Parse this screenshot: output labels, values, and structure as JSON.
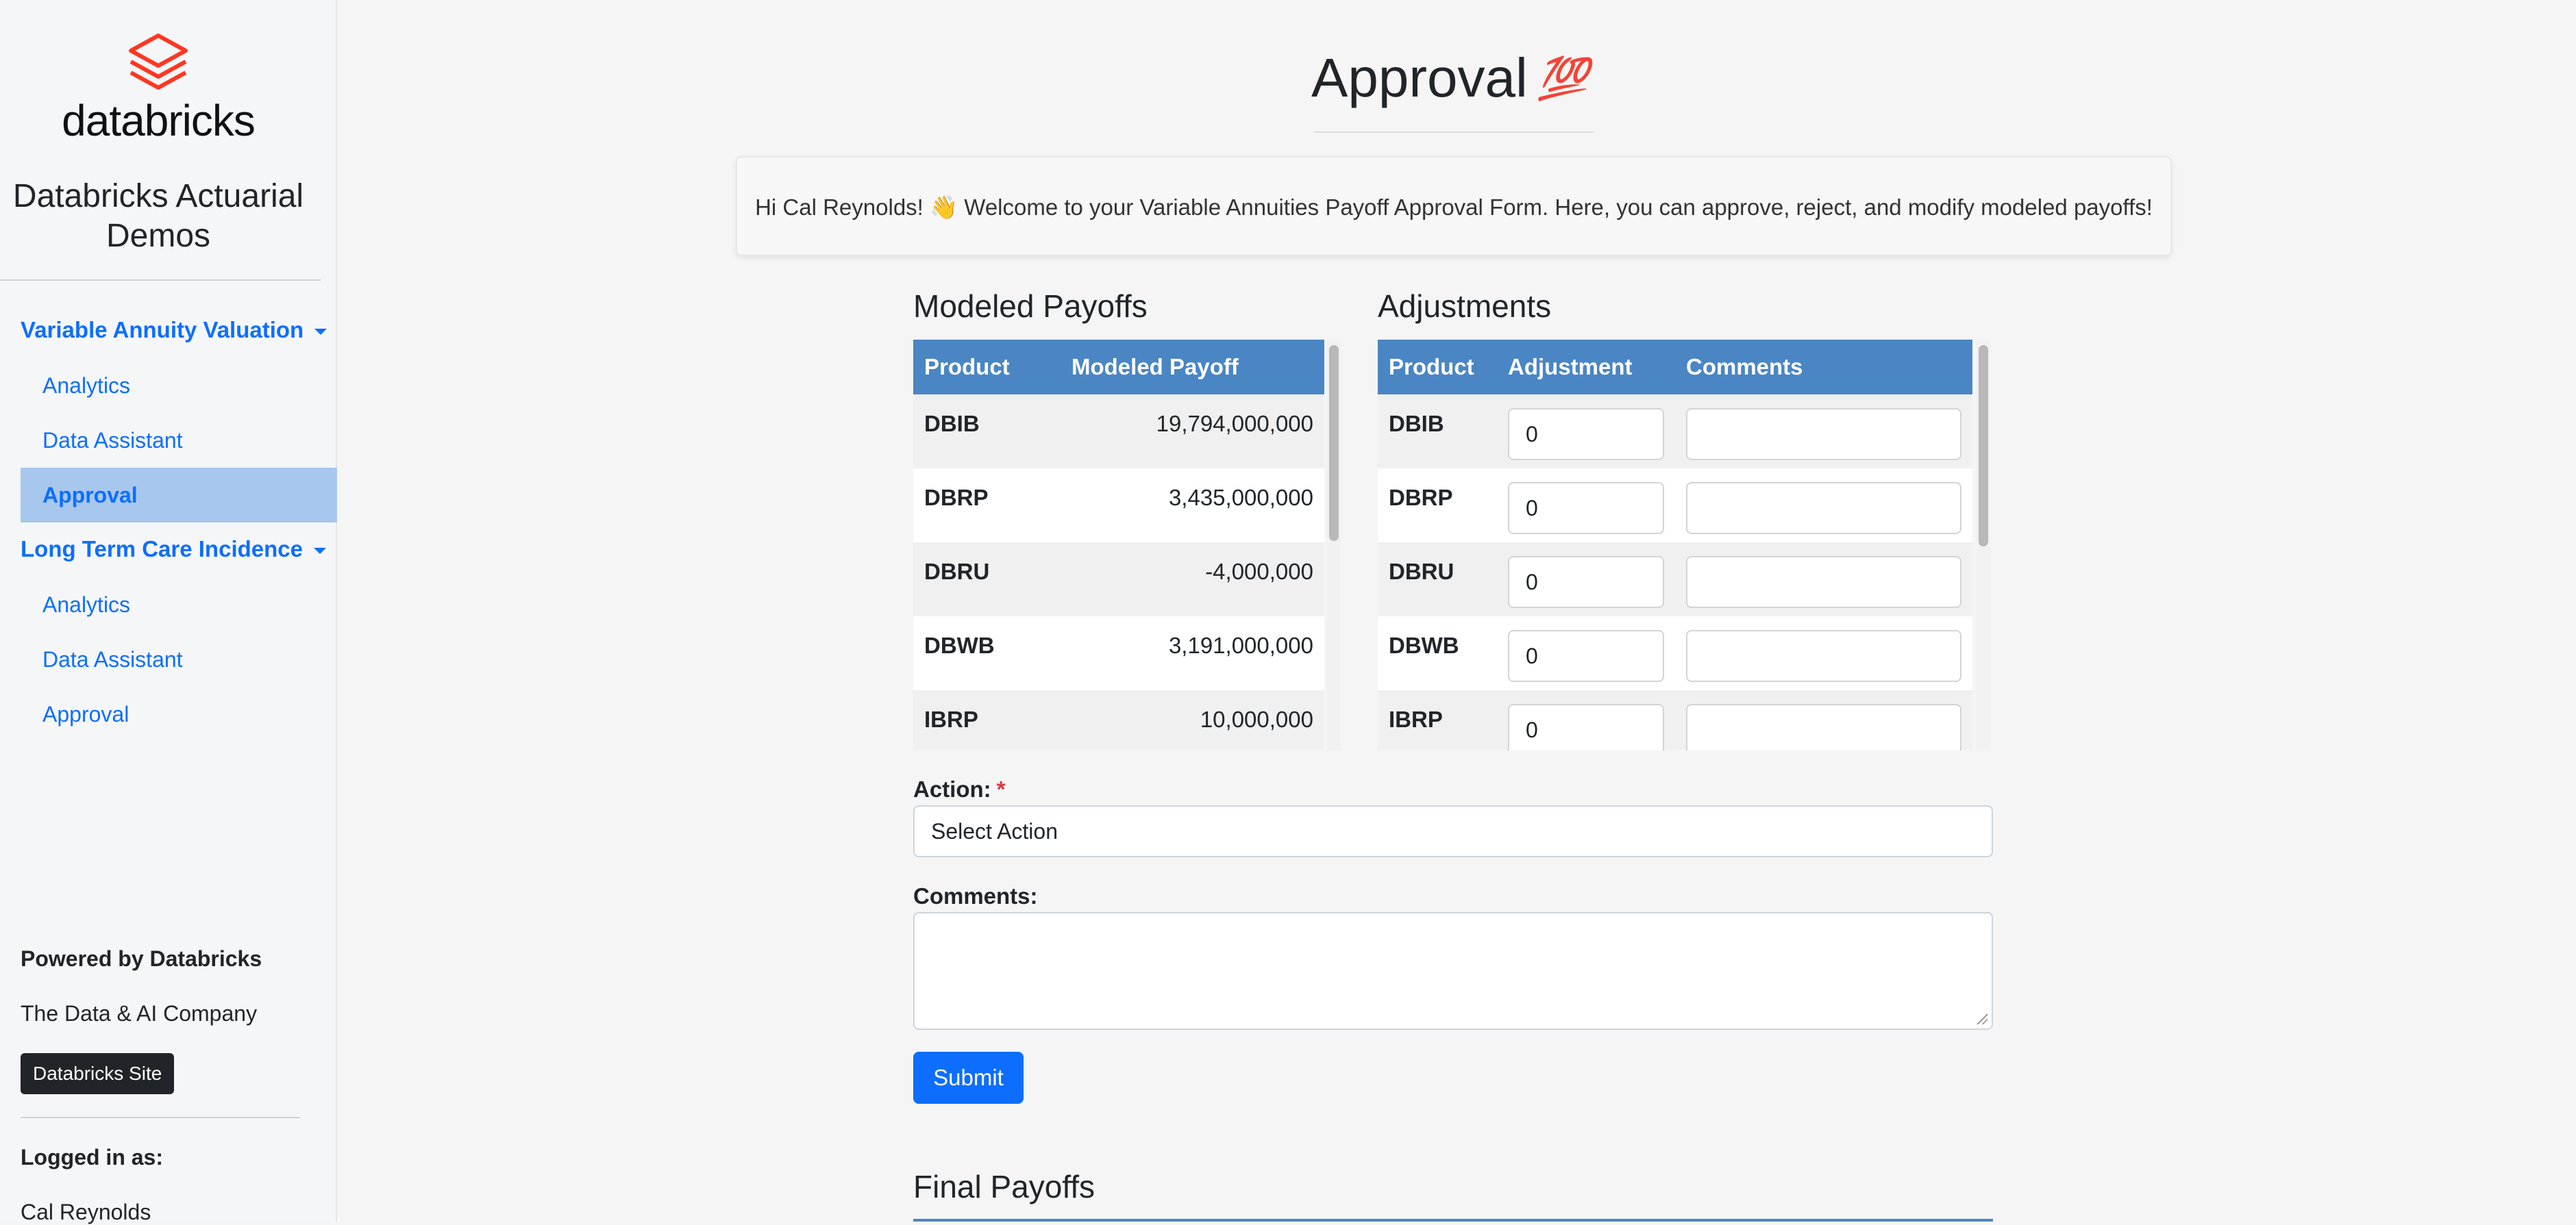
{
  "sidebar": {
    "brand": "databricks",
    "app_title": "Databricks Actuarial Demos",
    "sections": [
      {
        "label": "Variable Annuity Valuation",
        "items": [
          {
            "label": "Analytics",
            "active": false
          },
          {
            "label": "Data Assistant",
            "active": false
          },
          {
            "label": "Approval",
            "active": true
          }
        ]
      },
      {
        "label": "Long Term Care Incidence",
        "items": [
          {
            "label": "Analytics",
            "active": false
          },
          {
            "label": "Data Assistant",
            "active": false
          },
          {
            "label": "Approval",
            "active": false
          }
        ]
      }
    ],
    "powered_title": "Powered by Databricks",
    "powered_sub": "The Data & AI Company",
    "site_button": "Databricks Site",
    "logged_in_label": "Logged in as:",
    "logged_in_user": "Cal Reynolds"
  },
  "main": {
    "title": "Approval",
    "title_emoji": "💯",
    "welcome": "Hi Cal Reynolds! 👋 Welcome to your Variable Annuities Payoff Approval Form. Here, you can approve, reject, and modify modeled payoffs!",
    "modeled": {
      "heading": "Modeled Payoffs",
      "columns": [
        "Product",
        "Modeled Payoff"
      ],
      "rows": [
        {
          "product": "DBIB",
          "payoff": "19,794,000,000"
        },
        {
          "product": "DBRP",
          "payoff": "3,435,000,000"
        },
        {
          "product": "DBRU",
          "payoff": "-4,000,000"
        },
        {
          "product": "DBWB",
          "payoff": "3,191,000,000"
        },
        {
          "product": "IBRP",
          "payoff": "10,000,000"
        }
      ]
    },
    "adjustments": {
      "heading": "Adjustments",
      "columns": [
        "Product",
        "Adjustment",
        "Comments"
      ],
      "rows": [
        {
          "product": "DBIB",
          "adjustment": "0",
          "comment": ""
        },
        {
          "product": "DBRP",
          "adjustment": "0",
          "comment": ""
        },
        {
          "product": "DBRU",
          "adjustment": "0",
          "comment": ""
        },
        {
          "product": "DBWB",
          "adjustment": "0",
          "comment": ""
        },
        {
          "product": "IBRP",
          "adjustment": "0",
          "comment": ""
        }
      ]
    },
    "form": {
      "action_label": "Action:",
      "action_required_mark": "*",
      "action_value": "Select Action",
      "comments_label": "Comments:",
      "comments_value": "",
      "submit_label": "Submit"
    },
    "final_heading": "Final Payoffs"
  },
  "colors": {
    "accent": "#0d6efd",
    "table_header": "#4a86c4",
    "active_nav": "#a7c7ee",
    "logo_red": "#ff3621"
  }
}
